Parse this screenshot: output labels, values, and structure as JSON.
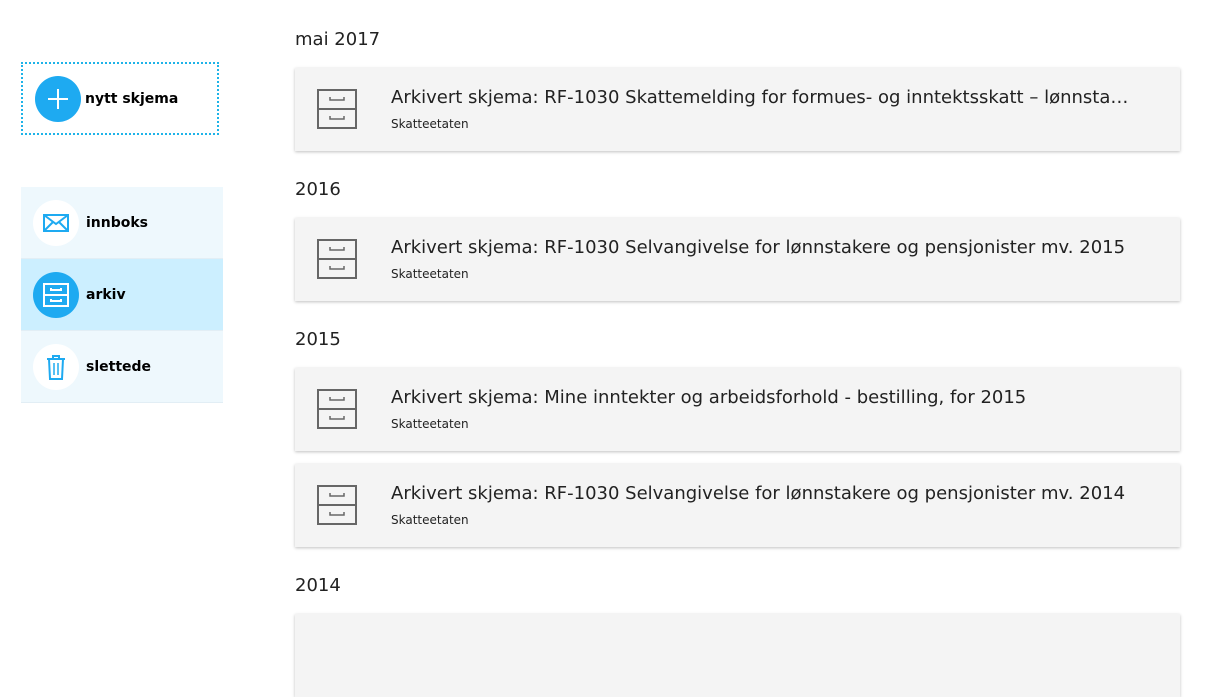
{
  "sidebar": {
    "new_form_label": "nytt skjema",
    "nav": [
      {
        "label": "innboks",
        "icon": "envelope-icon",
        "active": false
      },
      {
        "label": "arkiv",
        "icon": "archive-icon",
        "active": true
      },
      {
        "label": "slettede",
        "icon": "trash-icon",
        "active": false
      }
    ]
  },
  "colors": {
    "accent": "#1eaaf1",
    "nav_bg": "#eef8fd",
    "nav_active_bg": "#ccefff",
    "card_bg": "#f4f4f4"
  },
  "groups": [
    {
      "heading": "mai 2017",
      "items": [
        {
          "title": "Arkivert skjema: RF-1030 Skattemelding for formues- og inntektsskatt – lønnstak...",
          "org": "Skatteetaten"
        }
      ]
    },
    {
      "heading": "2016",
      "items": [
        {
          "title": "Arkivert skjema: RF-1030 Selvangivelse for lønnstakere og pensjonister mv. 2015",
          "org": "Skatteetaten"
        }
      ]
    },
    {
      "heading": "2015",
      "items": [
        {
          "title": "Arkivert skjema: Mine inntekter og arbeidsforhold - bestilling, for 2015",
          "org": "Skatteetaten"
        },
        {
          "title": "Arkivert skjema: RF-1030 Selvangivelse for lønnstakere og pensjonister mv. 2014",
          "org": "Skatteetaten"
        }
      ]
    },
    {
      "heading": "2014",
      "items": [
        {
          "title": "",
          "org": ""
        }
      ]
    }
  ]
}
